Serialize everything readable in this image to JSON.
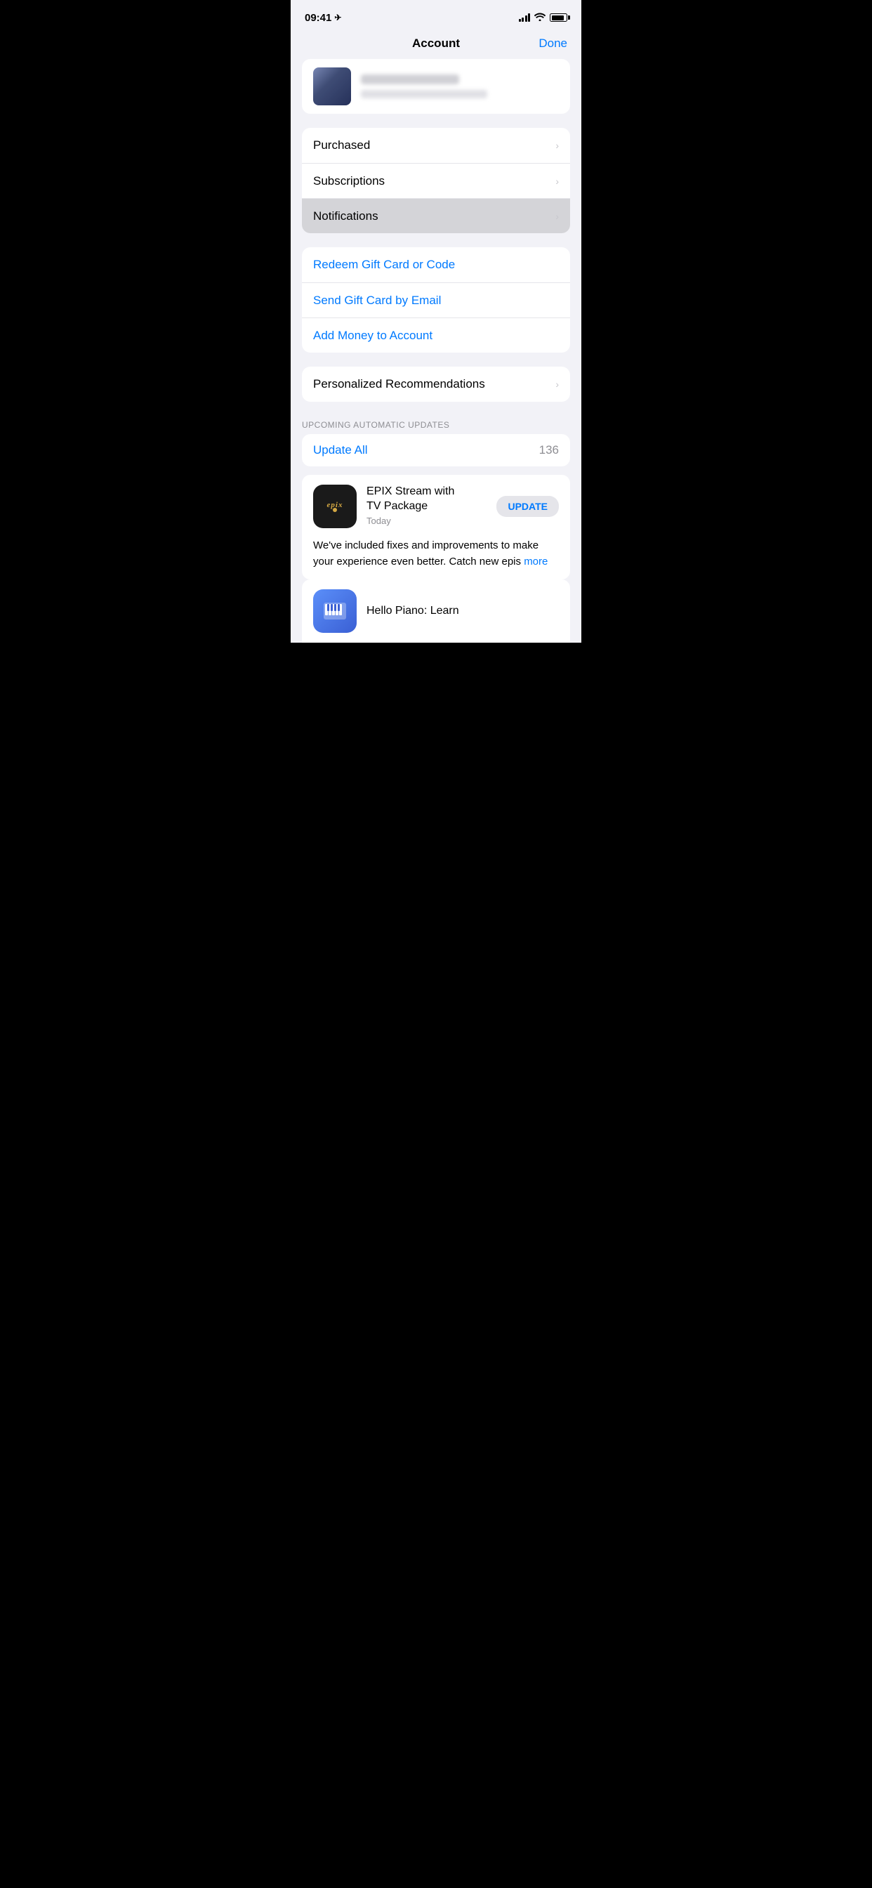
{
  "statusBar": {
    "time": "09:41",
    "locationIcon": "›"
  },
  "navBar": {
    "title": "Account",
    "doneLabel": "Done"
  },
  "menuSection1": {
    "items": [
      {
        "label": "Purchased",
        "hasChevron": true
      },
      {
        "label": "Subscriptions",
        "hasChevron": true
      },
      {
        "label": "Notifications",
        "hasChevron": true,
        "selected": true
      }
    ]
  },
  "menuSection2": {
    "items": [
      {
        "label": "Redeem Gift Card or Code",
        "hasChevron": false,
        "blue": true
      },
      {
        "label": "Send Gift Card by Email",
        "hasChevron": false,
        "blue": true
      },
      {
        "label": "Add Money to Account",
        "hasChevron": false,
        "blue": true
      }
    ]
  },
  "menuSection3": {
    "items": [
      {
        "label": "Personalized Recommendations",
        "hasChevron": true
      }
    ]
  },
  "upcomingUpdates": {
    "sectionLabel": "UPCOMING AUTOMATIC UPDATES",
    "updateAllLabel": "Update All",
    "updateCount": "136"
  },
  "epixApp": {
    "name": "EPIX Stream with\nTV Package",
    "date": "Today",
    "updateLabel": "UPDATE",
    "description": "We've included fixes and improvements to make your experience even better. Catch new epis",
    "moreLabel": "more",
    "iconText": "epix"
  },
  "helloPiano": {
    "label": "Hello Piano: Learn"
  }
}
